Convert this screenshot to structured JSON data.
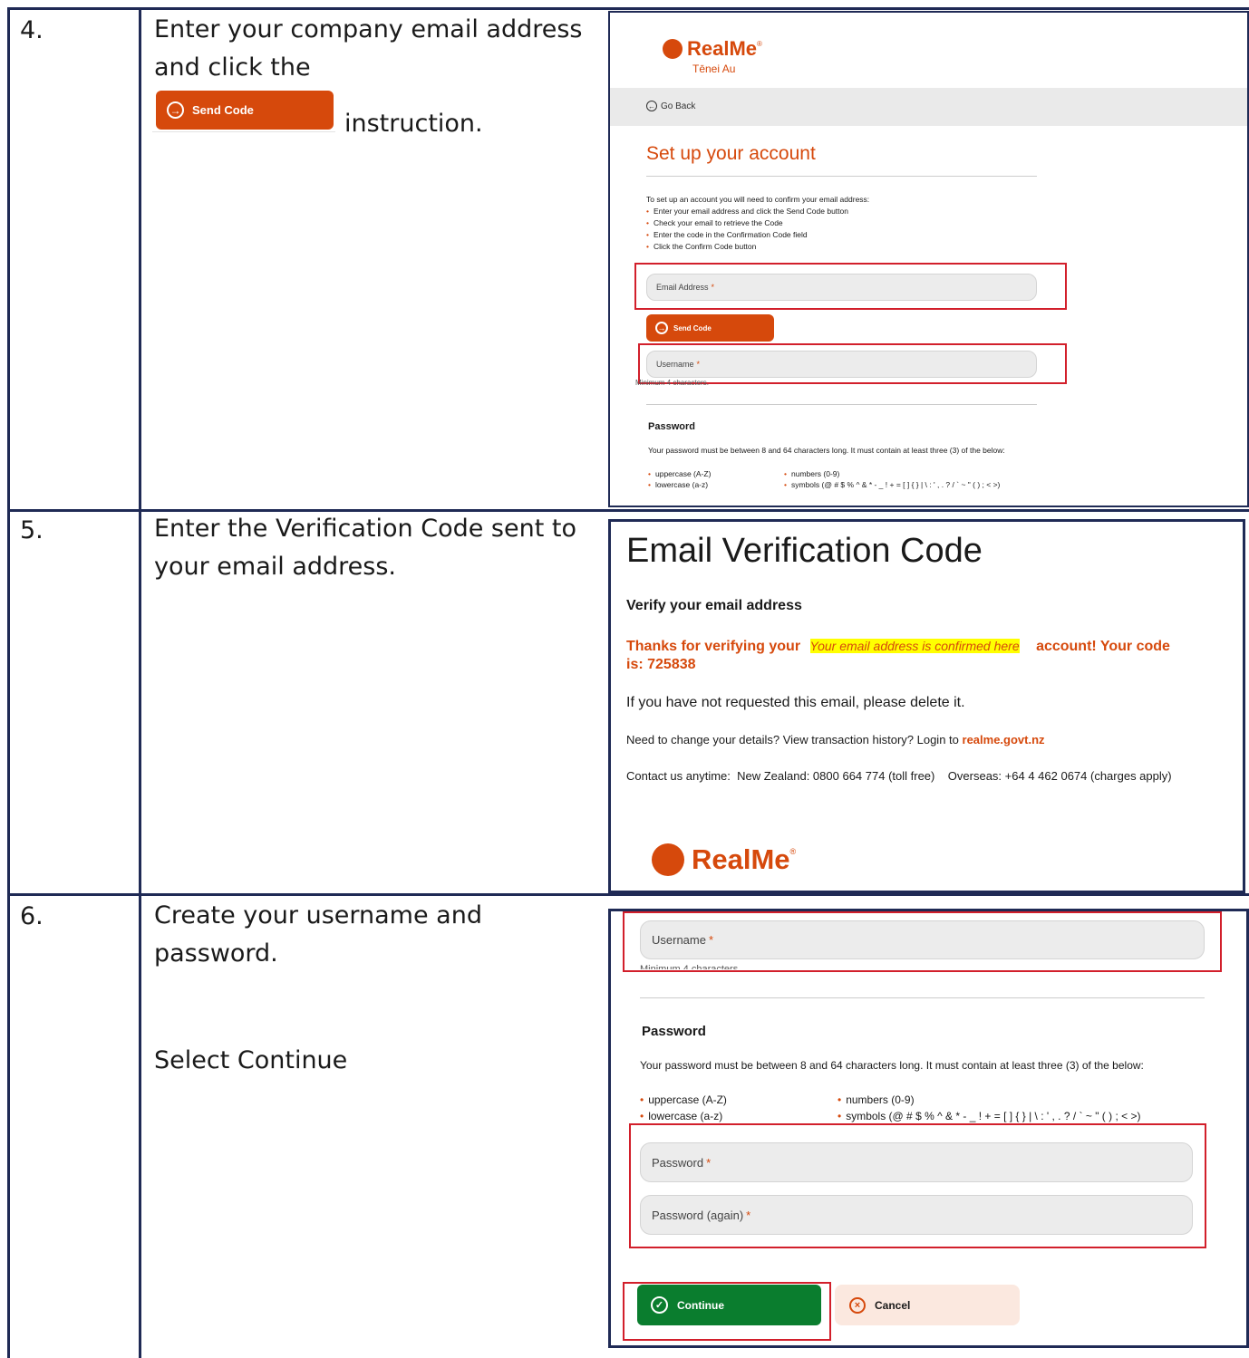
{
  "steps": [
    {
      "number": "4.",
      "instruction_pre": "Enter your company email address and click the",
      "inline_button": "Send Code",
      "instruction_post": "instruction."
    },
    {
      "number": "5.",
      "instruction": "Enter the Verification Code sent to your email address."
    },
    {
      "number": "6.",
      "instruction": "Create your username and password.",
      "instruction2": "Select Continue"
    }
  ],
  "setup": {
    "logo": "RealMe",
    "tagline": "Tēnei Au",
    "go_back": "Go Back",
    "title": "Set up your account",
    "intro": "To set up an account you will need to confirm your email address:",
    "bullets": [
      "Enter your email address and click the Send Code button",
      "Check your email to retrieve the Code",
      "Enter the code in the Confirmation Code field",
      "Click the Confirm Code button"
    ],
    "email_label": "Email Address",
    "send_code": "Send Code",
    "username_label": "Username",
    "username_hint": "Minimum 4 characters.",
    "password_heading": "Password",
    "password_rules": "Your password must be between 8 and 64 characters long. It must contain at least three (3) of the below:",
    "rules_left": [
      "uppercase (A-Z)",
      "lowercase (a-z)"
    ],
    "rules_right": [
      "numbers (0-9)",
      "symbols (@ # $ % ^ & * - _ ! + = [ ] { } | \\ : ' , . ? / ` ~ \" ( ) ; < >)"
    ]
  },
  "email": {
    "title": "Email Verification Code",
    "subtitle": "Verify your email address",
    "thanks_pre": "Thanks for verifying your",
    "highlight": "Your email address is confirmed here",
    "thanks_post": "account! Your code",
    "code_line": "is: 725838",
    "not_requested": "If you have not requested this email, please delete it.",
    "change_details": "Need to change your details? View transaction history? Login to",
    "link": "realme.govt.nz",
    "contact": "Contact us anytime:  New Zealand: 0800 664 774 (toll free)    Overseas: +64 4 462 0674 (charges apply)",
    "logo": "RealMe"
  },
  "create": {
    "username_label": "Username",
    "username_hint": "Minimum 4 characters",
    "password_heading": "Password",
    "password_rules": "Your password must be between 8 and 64 characters long. It must contain at least three (3) of the below:",
    "rules_left": [
      "uppercase (A-Z)",
      "lowercase (a-z)"
    ],
    "rules_right": [
      "numbers (0-9)",
      "symbols (@ # $ % ^ & * - _ ! + = [ ] { } | \\ : ' , . ? / ` ~ \" ( ) ; < >)"
    ],
    "password_label": "Password",
    "password_again_label": "Password (again)",
    "continue": "Continue",
    "cancel": "Cancel"
  },
  "colors": {
    "brand_orange": "#d6490c",
    "continue_green": "#0a7d2e",
    "highlight_yellow": "#ffff00",
    "table_border": "#1f2a55",
    "annotation_red": "#d21f2b"
  }
}
